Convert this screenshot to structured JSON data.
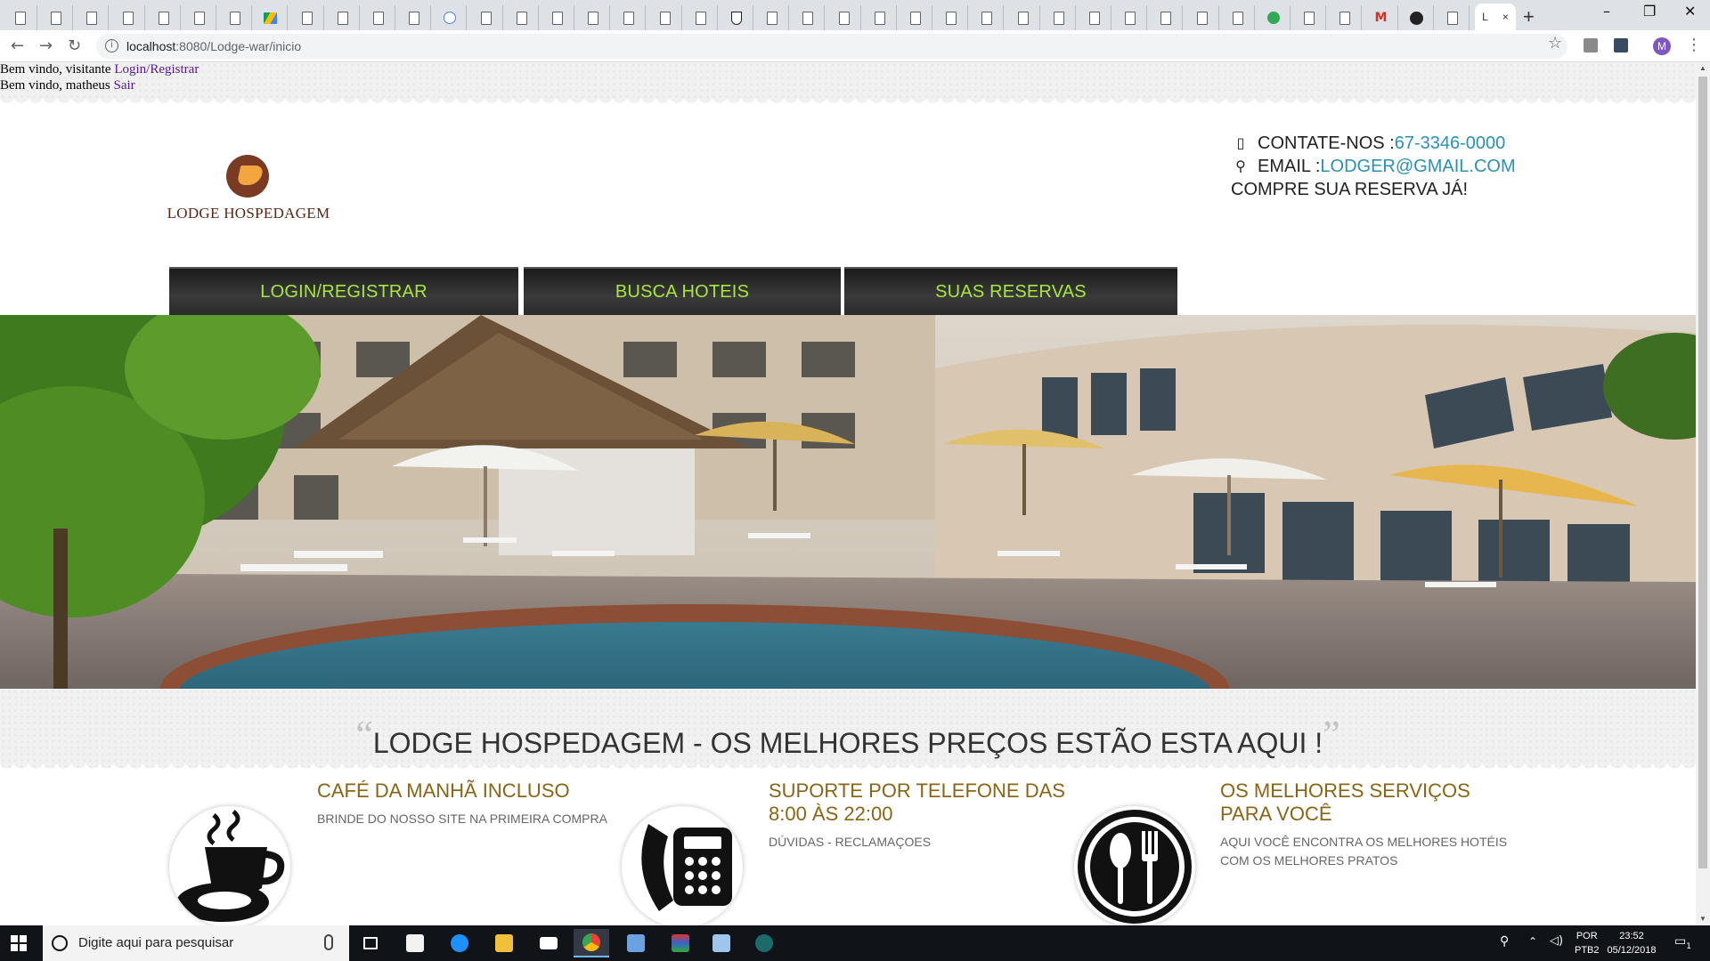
{
  "browser": {
    "tab_title": "L",
    "close_glyph": "×",
    "new_tab_glyph": "+",
    "url_host": "localhost",
    "url_rest": ":8080/Lodge-war/inicio",
    "profile_initial": "M",
    "window_controls": [
      "–",
      "❐",
      "✕"
    ]
  },
  "page": {
    "welcome_visitor": "Bem vindo, visitante ",
    "login_link": "Login/Registrar",
    "welcome_user": "Bem vindo, matheus ",
    "logout_link": "Sair",
    "logo_text": "LODGE HOSPEDAGEM",
    "contact": {
      "phone_label": "CONTATE-NOS : ",
      "phone_value": "67-3346-0000",
      "email_label": "EMAIL :",
      "email_value": "LODGER@GMAIL.COM",
      "cta": "COMPRE SUA RESERVA JÁ!"
    },
    "nav": [
      "LOGIN/REGISTRAR",
      "BUSCA HOTEIS",
      "SUAS RESERVAS"
    ],
    "tagline": "LODGE HOSPEDAGEM - OS MELHORES PREÇOS ESTÃO ESTA AQUI !",
    "features": [
      {
        "title_line1": "CAFÉ DA MANHÃ INCLUSO",
        "title_line2": "",
        "desc_line1": "BRINDE DO NOSSO SITE NA PRIMEIRA COMPRA",
        "desc_line2": "",
        "icon": "coffee-cup-icon"
      },
      {
        "title_line1": "SUPORTE POR TELEFONE DAS",
        "title_line2": "8:00 ÀS 22:00",
        "desc_line1": "DÚVIDAS - RECLAMAÇOES",
        "desc_line2": "",
        "icon": "telephone-icon"
      },
      {
        "title_line1": "OS MELHORES SERVIÇOS",
        "title_line2": "PARA VOCÊ",
        "desc_line1": "AQUI VOCÊ ENCONTRA OS MELHORES HOTÉIS",
        "desc_line2": "COM OS MELHORES PRATOS",
        "icon": "fork-spoon-icon"
      }
    ]
  },
  "taskbar": {
    "search_placeholder": "Digite aqui para pesquisar",
    "lang_line1": "POR",
    "lang_line2": "PTB2",
    "time": "23:52",
    "date": "05/12/2018",
    "notification_count": "1"
  },
  "colors": {
    "nav_text": "#a8e83b",
    "link_blue": "#2a90b8",
    "feature_title": "#8a6515",
    "logo_brown": "#7a3b22"
  }
}
